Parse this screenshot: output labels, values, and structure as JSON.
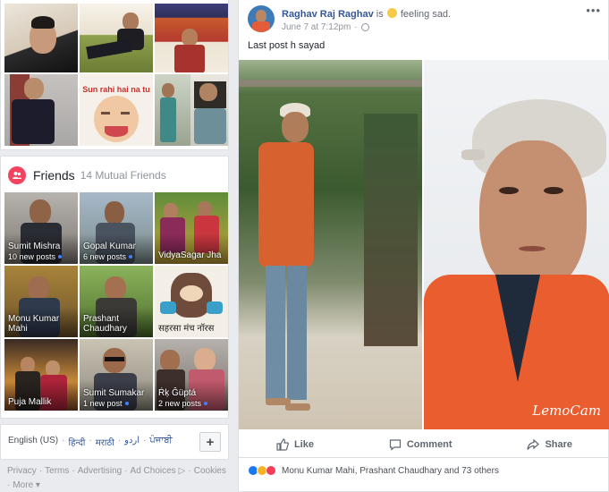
{
  "photos": {
    "tiles": [
      {
        "caption": ""
      },
      {
        "caption": ""
      },
      {
        "caption": ""
      },
      {
        "caption": ""
      },
      {
        "caption": "Sun rahi hai na tu"
      },
      {
        "caption": ""
      }
    ]
  },
  "friends": {
    "title": "Friends",
    "count": "14 Mutual Friends",
    "tiles": [
      {
        "name": "Sumit Mishra",
        "posts": "10 new posts"
      },
      {
        "name": "Gopal Kumar",
        "posts": "6 new posts"
      },
      {
        "name": "VidyaSagar Jha",
        "posts": ""
      },
      {
        "name": "Monu Kumar Mahi",
        "posts": ""
      },
      {
        "name": "Prashant Chaudhary",
        "posts": ""
      },
      {
        "name": "सहरसा मंच नॉरस",
        "posts": ""
      },
      {
        "name": "Puja Mallik",
        "posts": ""
      },
      {
        "name": "Sumit Sumakar",
        "posts": "1 new post"
      },
      {
        "name": "Ŕķ Ĝüptá",
        "posts": "2 new posts"
      }
    ]
  },
  "language": {
    "current": "English (US)",
    "options": [
      "हिन्दी",
      "मराठी",
      "اردو",
      "ਪੰਜਾਬੀ"
    ],
    "add_label": "+"
  },
  "footer": {
    "links": [
      "Privacy",
      "·",
      "Terms",
      "·",
      "Advertising",
      "·",
      "Ad Choices",
      "▷",
      "·",
      "Cookies",
      "·"
    ],
    "more": "More"
  },
  "post": {
    "author": "Raghav Raj Raghav",
    "is_text": "is",
    "feeling": "feeling sad.",
    "date": "June 7 at 7:12pm",
    "dot": "·",
    "more_icon": "•••",
    "caption": "Last post h sayad",
    "watermark": "LemoCam",
    "actions": {
      "like": "Like",
      "comment": "Comment",
      "share": "Share"
    },
    "reactions": "Monu Kumar Mahi, Prashant Chaudhary and 73 others"
  },
  "colors": {
    "link": "#365899",
    "like": "#1877f2",
    "haha": "#f7b125",
    "love": "#f33e58",
    "friends_icon": "#f3425f"
  }
}
